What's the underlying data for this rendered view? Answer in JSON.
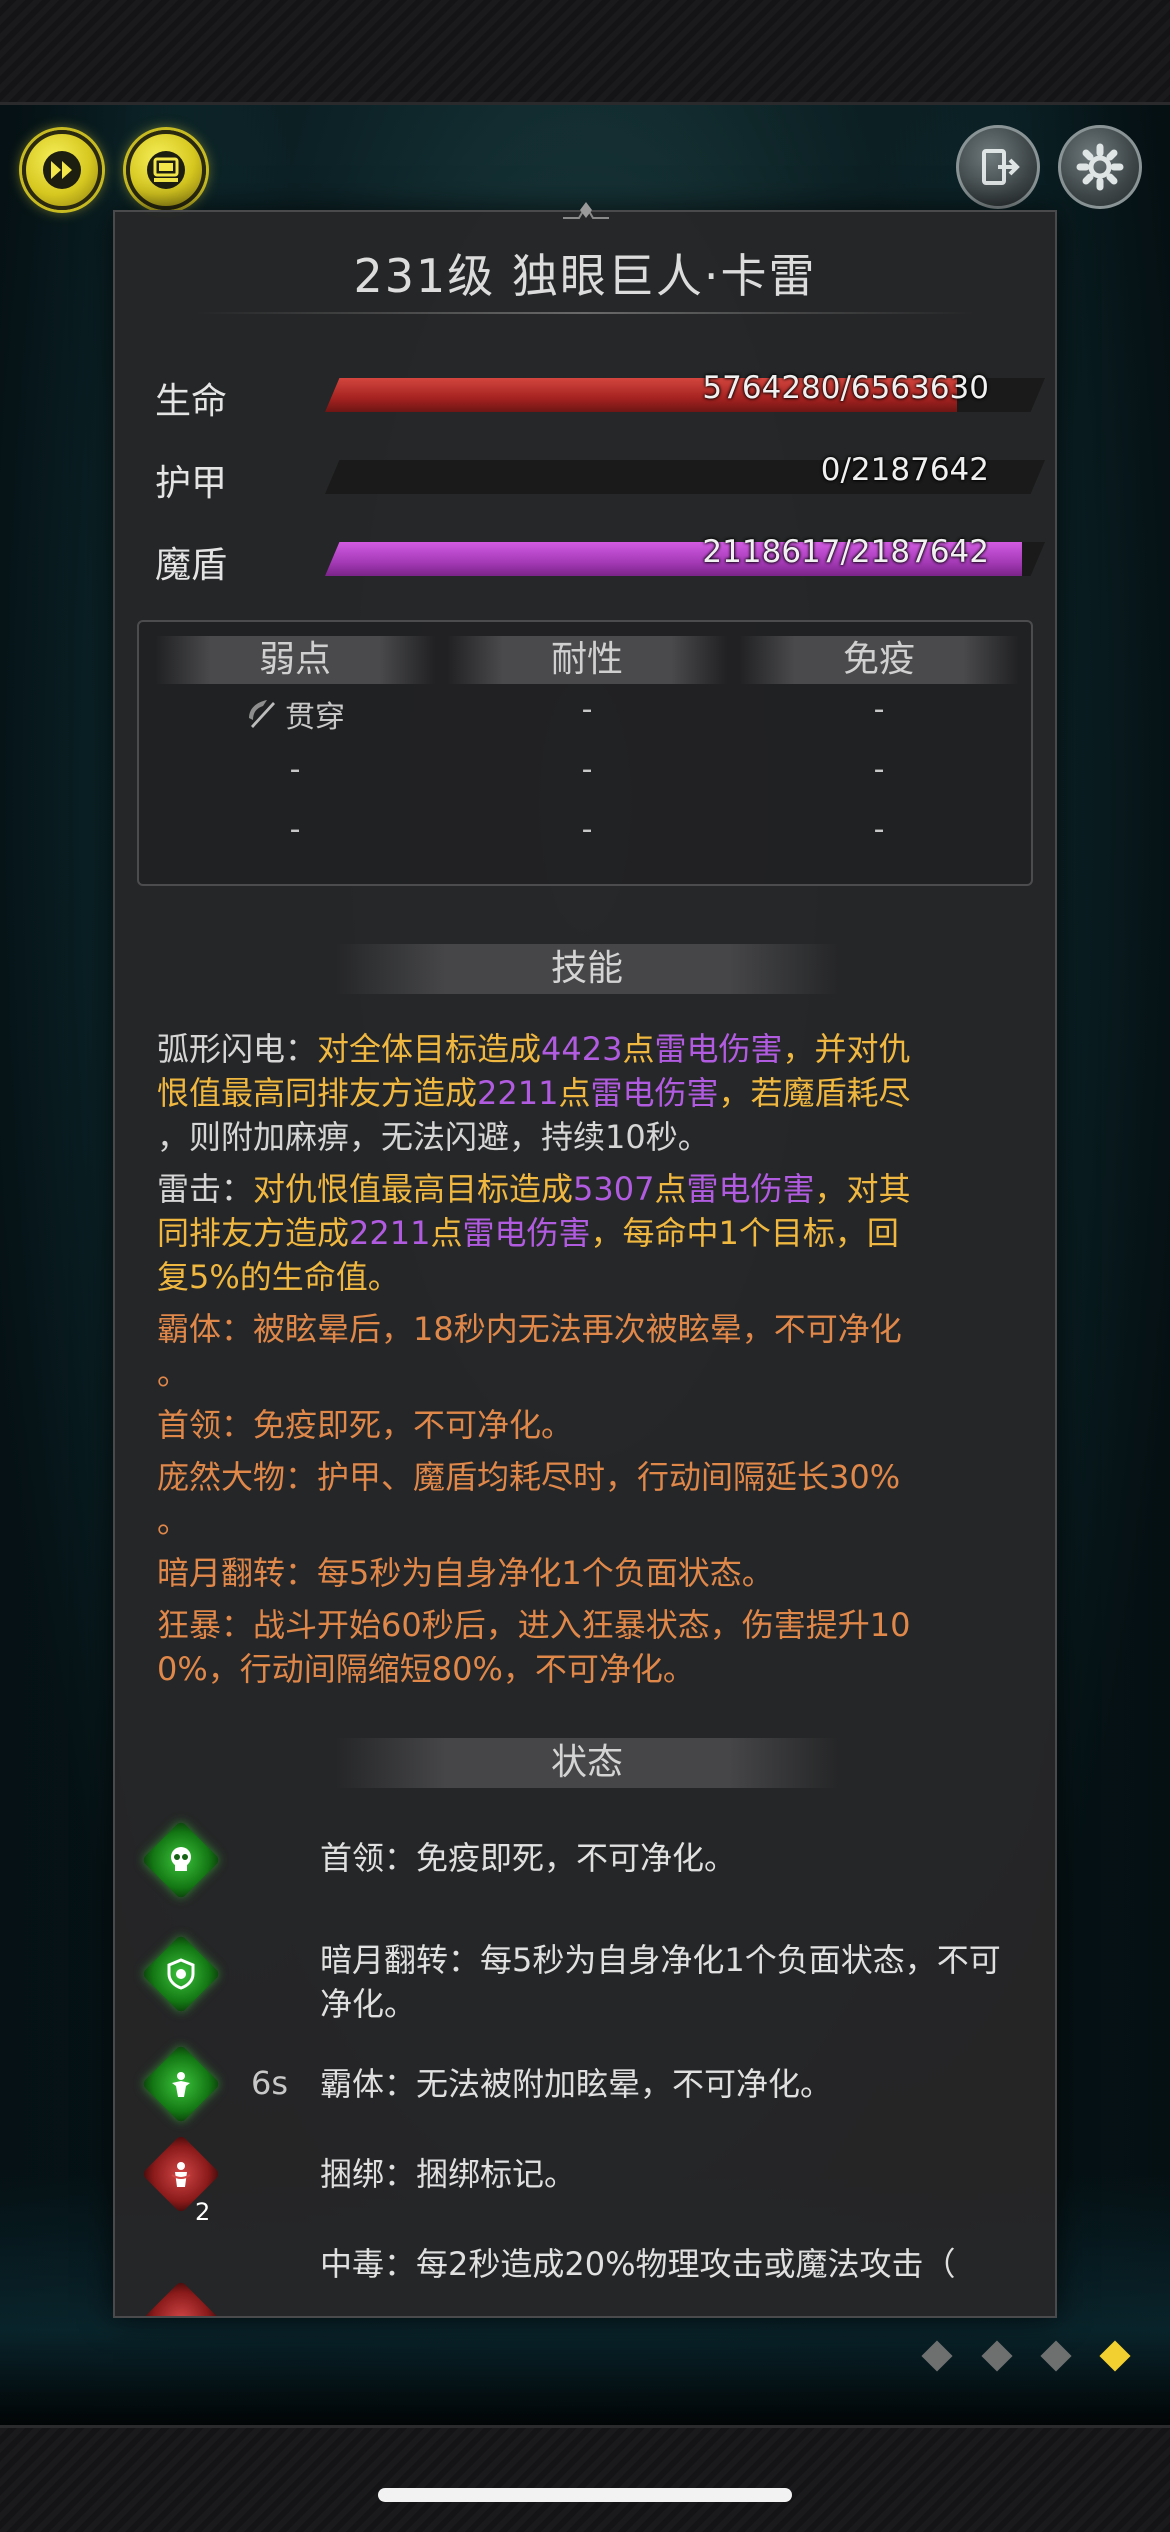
{
  "top_buttons": {
    "left": [
      {
        "name": "fast-forward-icon"
      },
      {
        "name": "auto-battle-icon"
      }
    ],
    "right": [
      {
        "name": "exit-icon"
      },
      {
        "name": "gear-icon"
      }
    ]
  },
  "boss": {
    "title": "231级  独眼巨人·卡雷"
  },
  "stats": [
    {
      "label": "生命",
      "value_text": "5764280/6563630",
      "fill": 0.878,
      "color": "#c1302b"
    },
    {
      "label": "护甲",
      "value_text": "0/2187642",
      "fill": 0.0,
      "color": "#1a1a1a"
    },
    {
      "label": "魔盾",
      "value_text": "2118617/2187642",
      "fill": 0.968,
      "color": "#a43ab6"
    }
  ],
  "resist_table": {
    "headers": [
      "弱点",
      "耐性",
      "免疫"
    ],
    "rows": [
      [
        "贯穿",
        "-",
        "-"
      ],
      [
        "-",
        "-",
        "-"
      ],
      [
        "-",
        "-",
        "-"
      ]
    ]
  },
  "skills_header": "技能",
  "skills": [
    {
      "segments": [
        {
          "t": "弧形闪电：",
          "c": "w"
        },
        {
          "t": "对全体目标造成",
          "c": "y"
        },
        {
          "t": "4423",
          "c": "p"
        },
        {
          "t": "点",
          "c": "y"
        },
        {
          "t": "雷电伤害",
          "c": "p"
        },
        {
          "t": "，并对仇",
          "c": "y"
        }
      ]
    },
    {
      "segments": [
        {
          "t": "恨值最高同排友方造成",
          "c": "y"
        },
        {
          "t": "2211",
          "c": "p"
        },
        {
          "t": "点",
          "c": "y"
        },
        {
          "t": "雷电伤害",
          "c": "p"
        },
        {
          "t": "，若魔盾耗尽",
          "c": "y"
        }
      ]
    },
    {
      "segments": [
        {
          "t": "，则附加麻痹，无法闪避，持续10秒。",
          "c": "w"
        }
      ]
    },
    {
      "gap": true,
      "segments": [
        {
          "t": "雷击：",
          "c": "w"
        },
        {
          "t": "对仇恨值最高目标造成",
          "c": "y"
        },
        {
          "t": "5307",
          "c": "p"
        },
        {
          "t": "点",
          "c": "y"
        },
        {
          "t": "雷电伤害",
          "c": "p"
        },
        {
          "t": "，对其",
          "c": "y"
        }
      ]
    },
    {
      "segments": [
        {
          "t": "同排友方造成",
          "c": "y"
        },
        {
          "t": "2211",
          "c": "p"
        },
        {
          "t": "点",
          "c": "y"
        },
        {
          "t": "雷电伤害",
          "c": "p"
        },
        {
          "t": "，每命中1个目标，回",
          "c": "y"
        }
      ]
    },
    {
      "segments": [
        {
          "t": "复5%的生命值。",
          "c": "y"
        }
      ]
    },
    {
      "gap": true,
      "segments": [
        {
          "t": "霸体：被眩晕后，18秒内无法再次被眩晕，不可净化",
          "c": "o"
        }
      ]
    },
    {
      "segments": [
        {
          "t": "。",
          "c": "o"
        }
      ]
    },
    {
      "gap": true,
      "segments": [
        {
          "t": "首领：免疫即死，不可净化。",
          "c": "o"
        }
      ]
    },
    {
      "gap": true,
      "segments": [
        {
          "t": "庞然大物：护甲、魔盾均耗尽时，行动间隔延长30%",
          "c": "o"
        }
      ]
    },
    {
      "segments": [
        {
          "t": "。",
          "c": "o"
        }
      ]
    },
    {
      "gap": true,
      "segments": [
        {
          "t": "暗月翻转：每5秒为自身净化1个负面状态。",
          "c": "o"
        }
      ]
    },
    {
      "gap": true,
      "segments": [
        {
          "t": "狂暴：战斗开始60秒后，进入狂暴状态，伤害提升10",
          "c": "o"
        }
      ]
    },
    {
      "segments": [
        {
          "t": "0%，行动间隔缩短80%，不可净化。",
          "c": "o"
        }
      ]
    }
  ],
  "status_header": "状态",
  "statuses": [
    {
      "icon": "skull-icon",
      "color": "green",
      "timer": "",
      "stack": "",
      "text": "首领：免疫即死，不可净化。"
    },
    {
      "icon": "shield-moon-icon",
      "color": "green",
      "timer": "",
      "stack": "",
      "text": "暗月翻转：每5秒为自身净化1个负面状态，不可净化。"
    },
    {
      "icon": "stance-icon",
      "color": "green",
      "timer": "6s",
      "stack": "",
      "text": "霸体：无法被附加眩晕，不可净化。"
    },
    {
      "icon": "bind-icon",
      "color": "red",
      "timer": "",
      "stack": "2",
      "text": "捆绑：捆绑标记。"
    },
    {
      "icon": "poison-icon",
      "color": "red",
      "timer": "",
      "stack": "",
      "text": "中毒：每2秒造成20%物理攻击或魔法攻击（"
    }
  ],
  "pager": {
    "count": 4,
    "active_index": 3
  }
}
